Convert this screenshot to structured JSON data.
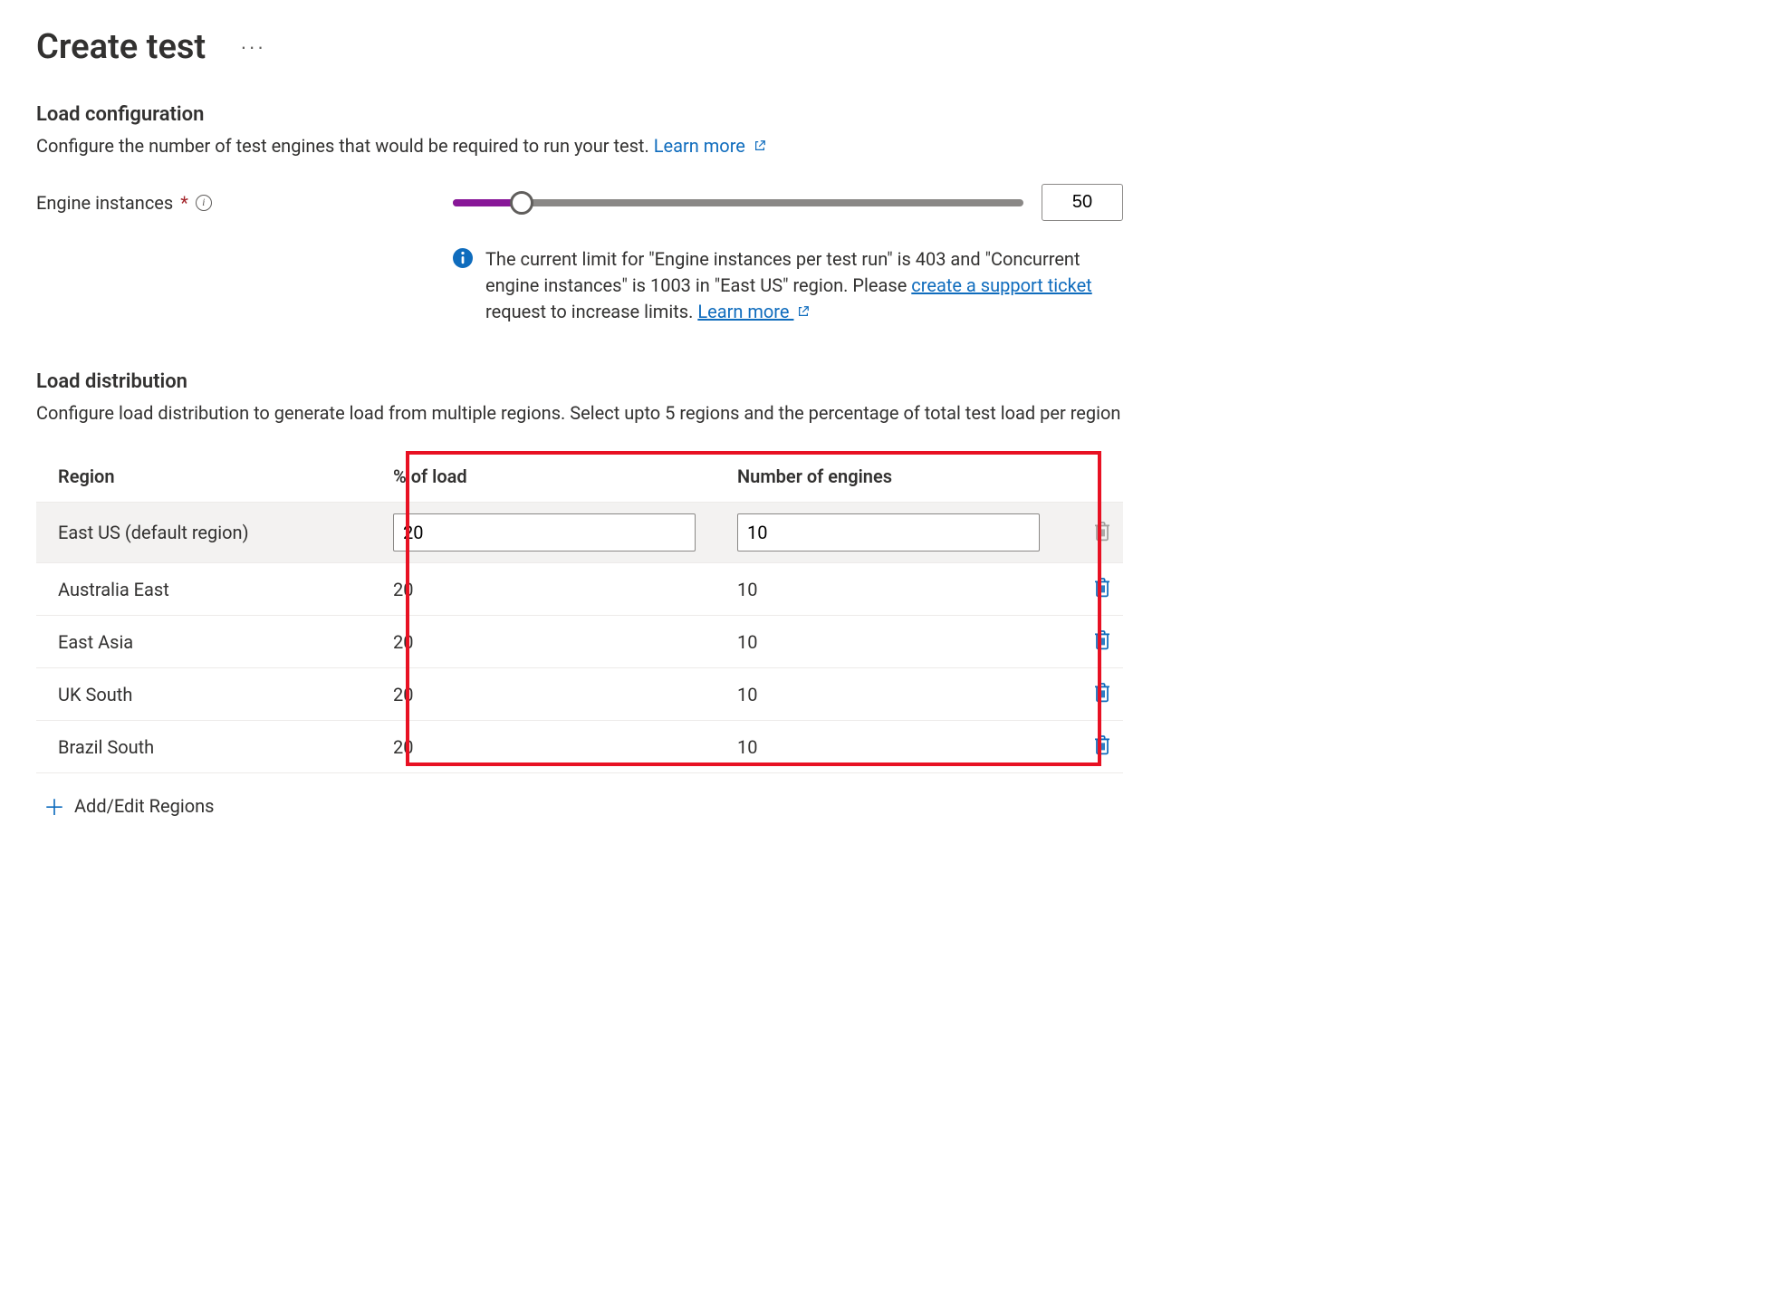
{
  "header": {
    "title": "Create test",
    "more_actions_label": "···"
  },
  "load_config": {
    "section_title": "Load configuration",
    "description": "Configure the number of test engines that would be required to run your test. ",
    "learn_more_label": "Learn more",
    "engine_instances_label": "Engine instances",
    "required_marker": "*",
    "engine_instances_value": "50",
    "banner_text_before": "The current limit for \"Engine instances per test run\" is 403 and \"Concurrent engine instances\" is 1003 in \"East US\" region. Please ",
    "banner_link1": "create a support ticket",
    "banner_text_mid": " request to increase limits. ",
    "banner_link2": "Learn more"
  },
  "load_dist": {
    "section_title": "Load distribution",
    "description": "Configure load distribution to generate load from multiple regions. Select upto 5 regions and the percentage of total test load per region",
    "columns": {
      "region": "Region",
      "pct": "% of load",
      "engines": "Number of engines"
    },
    "rows": [
      {
        "region": "East US (default region)",
        "pct": "20",
        "engines": "10",
        "default": true
      },
      {
        "region": "Australia East",
        "pct": "20",
        "engines": "10",
        "default": false
      },
      {
        "region": "East Asia",
        "pct": "20",
        "engines": "10",
        "default": false
      },
      {
        "region": "UK South",
        "pct": "20",
        "engines": "10",
        "default": false
      },
      {
        "region": "Brazil South",
        "pct": "20",
        "engines": "10",
        "default": false
      }
    ],
    "add_label": "Add/Edit Regions"
  }
}
